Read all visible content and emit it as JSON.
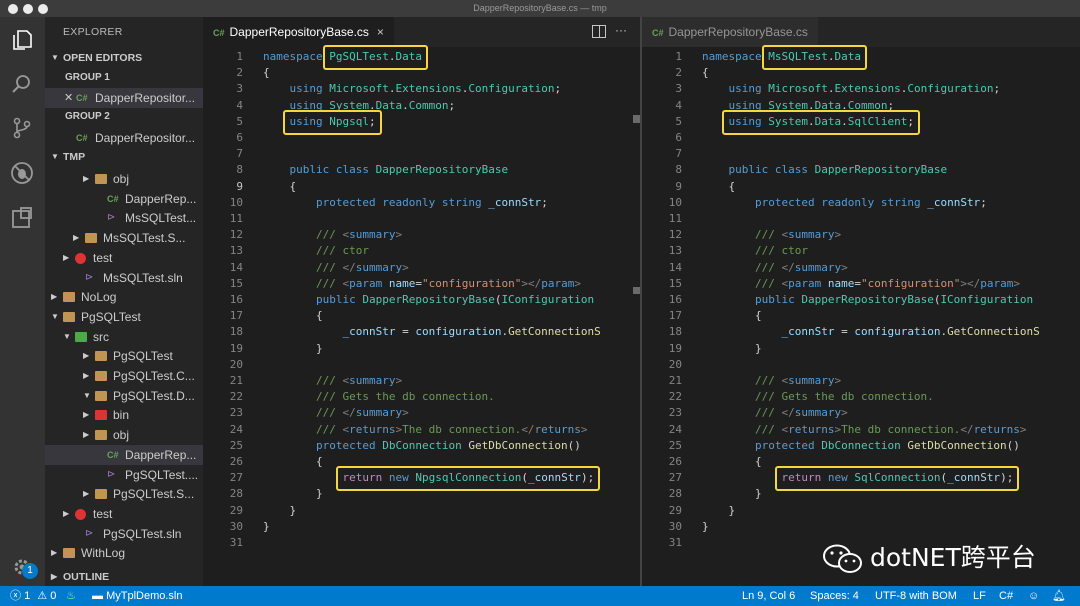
{
  "window": {
    "title": "DapperRepositoryBase.cs — tmp"
  },
  "sidebar": {
    "title": "EXPLORER",
    "open_editors": "OPEN EDITORS",
    "group1": "GROUP 1",
    "group1_file": "DapperRepositor...",
    "group2": "GROUP 2",
    "group2_file": "DapperRepositor...",
    "tmp": "TMP",
    "outline": "OUTLINE",
    "tree": [
      {
        "label": "obj",
        "type": "folder"
      },
      {
        "label": "DapperRep...",
        "type": "cs"
      },
      {
        "label": "MsSQLTest...",
        "type": "csproj"
      },
      {
        "label": "MsSQLTest.S...",
        "type": "folder"
      },
      {
        "label": "test",
        "type": "test"
      },
      {
        "label": "MsSQLTest.sln",
        "type": "sln"
      },
      {
        "label": "NoLog",
        "type": "folder"
      },
      {
        "label": "PgSQLTest",
        "type": "folder"
      },
      {
        "label": "src",
        "type": "src"
      },
      {
        "label": "PgSQLTest",
        "type": "folder"
      },
      {
        "label": "PgSQLTest.C...",
        "type": "folder"
      },
      {
        "label": "PgSQLTest.D...",
        "type": "folder"
      },
      {
        "label": "bin",
        "type": "bin"
      },
      {
        "label": "obj",
        "type": "folder"
      },
      {
        "label": "DapperRep...",
        "type": "cs"
      },
      {
        "label": "PgSQLTest....",
        "type": "csproj"
      },
      {
        "label": "PgSQLTest.S...",
        "type": "folder"
      },
      {
        "label": "test",
        "type": "test"
      },
      {
        "label": "PgSQLTest.sln",
        "type": "sln"
      },
      {
        "label": "WithLog",
        "type": "folder"
      }
    ]
  },
  "editors": [
    {
      "tab": {
        "icon": "C#",
        "label": "DapperRepositoryBase.cs",
        "close": "×"
      },
      "lines": [
        "namespace PgSQLTest.Data",
        "{",
        "    using Microsoft.Extensions.Configuration;",
        "    using System.Data.Common;",
        "    using Npgsql;",
        "",
        "",
        "    public class DapperRepositoryBase",
        "    {",
        "        protected readonly string _connStr;",
        "",
        "        /// <summary>",
        "        /// ctor",
        "        /// </summary>",
        "        /// <param name=\"configuration\"></param>",
        "        public DapperRepositoryBase(IConfiguration",
        "        {",
        "            _connStr = configuration.GetConnectionS",
        "        }",
        "",
        "        /// <summary>",
        "        /// Gets the db connection.",
        "        /// </summary>",
        "        /// <returns>The db connection.</returns>",
        "        protected DbConnection GetDbConnection()",
        "        {",
        "            return new NpgsqlConnection(_connStr);",
        "        }",
        "    }",
        "}",
        ""
      ]
    },
    {
      "tab": {
        "icon": "C#",
        "label": "DapperRepositoryBase.cs"
      },
      "lines": [
        "namespace MsSQLTest.Data",
        "{",
        "    using Microsoft.Extensions.Configuration;",
        "    using System.Data.Common;",
        "    using System.Data.SqlClient;",
        "",
        "",
        "    public class DapperRepositoryBase",
        "    {",
        "        protected readonly string _connStr;",
        "",
        "        /// <summary>",
        "        /// ctor",
        "        /// </summary>",
        "        /// <param name=\"configuration\"></param>",
        "        public DapperRepositoryBase(IConfiguration",
        "        {",
        "            _connStr = configuration.GetConnectionS",
        "        }",
        "",
        "        /// <summary>",
        "        /// Gets the db connection.",
        "        /// </summary>",
        "        /// <returns>The db connection.</returns>",
        "        protected DbConnection GetDbConnection()",
        "        {",
        "            return new SqlConnection(_connStr);",
        "        }",
        "    }",
        "}",
        ""
      ]
    }
  ],
  "status": {
    "errors": "1",
    "warnings": "0",
    "solution": "MyTplDemo.sln",
    "position": "Ln 9, Col 6",
    "spaces": "Spaces: 4",
    "encoding": "UTF-8 with BOM",
    "eol": "LF",
    "language": "C#"
  },
  "activity_badge": "1",
  "watermark": "dotNET跨平台",
  "colors": {
    "keyword": "#569cd6",
    "type": "#4ec9b0",
    "string": "#ce9178",
    "comment": "#6a9955",
    "control": "#c586c0",
    "method": "#dcdcaa",
    "variable": "#9cdcfe",
    "highlight": "#f2d740",
    "statusbar": "#007acc"
  }
}
